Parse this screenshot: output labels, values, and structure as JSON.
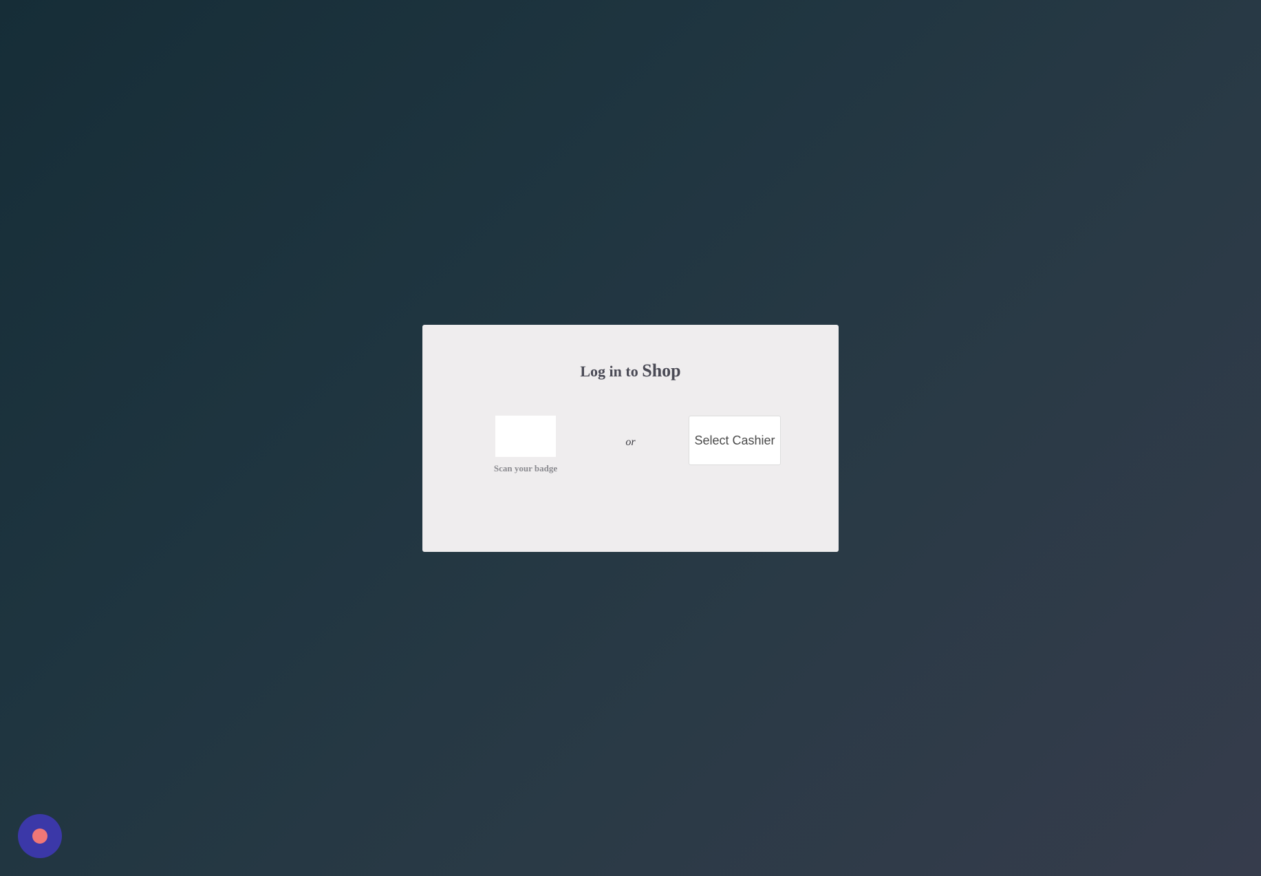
{
  "login": {
    "title_prefix": "Log in to ",
    "shop_name": "Shop",
    "badge_label": "Scan your badge",
    "or_text": "or",
    "select_cashier_label": "Select Cashier"
  },
  "record_button": {
    "icon": "record-dot-icon",
    "color": "#3b38a8",
    "dot_color": "#f07777"
  },
  "colors": {
    "panel_background": "#efedee",
    "background_start": "#162d37",
    "background_end": "#363c4c"
  }
}
